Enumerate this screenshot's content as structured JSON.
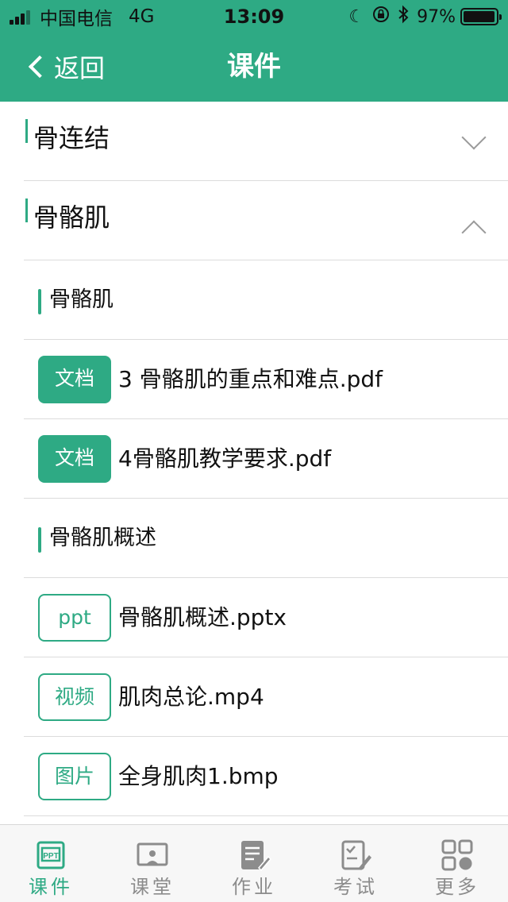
{
  "status_bar": {
    "carrier": "中国电信",
    "network": "4G",
    "time": "13:09",
    "battery": "97%",
    "battery_level": 0.97
  },
  "nav": {
    "back_label": "返回",
    "title": "课件"
  },
  "chapters": [
    {
      "title": "骨连结",
      "expanded": false
    },
    {
      "title": "骨骼肌",
      "expanded": true
    }
  ],
  "sections": [
    {
      "title": "骨骼肌",
      "files": [
        {
          "tag": "文档",
          "style": "solid",
          "name": "3 骨骼肌的重点和难点.pdf"
        },
        {
          "tag": "文档",
          "style": "solid",
          "name": "4骨骼肌教学要求.pdf"
        }
      ]
    },
    {
      "title": "骨骼肌概述",
      "files": [
        {
          "tag": "ppt",
          "style": "outline",
          "name": "骨骼肌概述.pptx"
        },
        {
          "tag": "视频",
          "style": "outline",
          "name": "肌肉总论.mp4"
        },
        {
          "tag": "图片",
          "style": "outline",
          "name": "全身肌肉1.bmp"
        }
      ]
    }
  ],
  "tabs": [
    {
      "label": "课件",
      "icon": "courseware-icon",
      "active": true
    },
    {
      "label": "课堂",
      "icon": "classroom-icon",
      "active": false
    },
    {
      "label": "作业",
      "icon": "homework-icon",
      "active": false
    },
    {
      "label": "考试",
      "icon": "exam-icon",
      "active": false
    },
    {
      "label": "更多",
      "icon": "more-icon",
      "active": false
    }
  ],
  "colors": {
    "accent": "#2eaa84",
    "inactive": "#8c8c8c",
    "divider": "#dcdcdc"
  }
}
